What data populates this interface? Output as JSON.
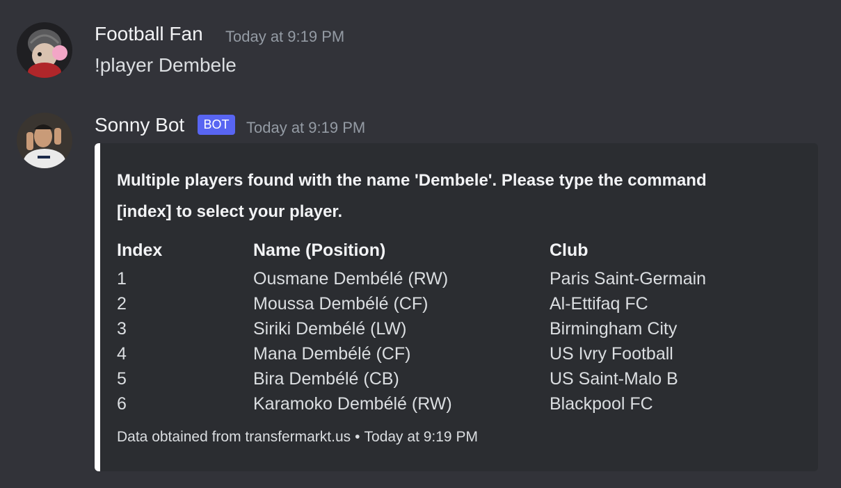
{
  "messages": [
    {
      "author": "Football Fan",
      "timestamp": "Today at 9:19 PM",
      "text": "!player Dembele"
    },
    {
      "author": "Sonny Bot",
      "badge": "BOT",
      "timestamp": "Today at 9:19 PM",
      "embed": {
        "description_line1": "Multiple players found with the name 'Dembele'. Please type the command",
        "description_line2": "[index] to select your player.",
        "columns": [
          "Index",
          "Name (Position)",
          "Club"
        ],
        "rows": [
          {
            "index": "1",
            "name": "Ousmane Dembélé (RW)",
            "club": "Paris Saint-Germain"
          },
          {
            "index": "2",
            "name": "Moussa Dembélé (CF)",
            "club": "Al-Ettifaq FC"
          },
          {
            "index": "3",
            "name": "Siriki Dembélé (LW)",
            "club": "Birmingham City"
          },
          {
            "index": "4",
            "name": "Mana Dembélé (CF)",
            "club": "US Ivry Football"
          },
          {
            "index": "5",
            "name": "Bira Dembélé (CB)",
            "club": "US Saint-Malo B"
          },
          {
            "index": "6",
            "name": "Karamoko Dembélé (RW)",
            "club": "Blackpool FC"
          }
        ],
        "footer_text": "Data obtained from transfermarkt.us",
        "footer_separator": "•",
        "footer_timestamp": "Today at 9:19 PM"
      }
    }
  ],
  "colors": {
    "background": "#323339",
    "embed_background": "#2b2d31",
    "embed_accent": "#ffffff",
    "bot_badge": "#5865f2"
  },
  "icons": {
    "user_avatar": "avatar-bubblegum-character-icon",
    "bot_avatar": "avatar-football-player-icon"
  }
}
